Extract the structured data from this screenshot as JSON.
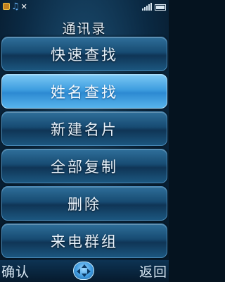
{
  "status_bar": {
    "icons": [
      "app-logo-icon",
      "music-note-icon",
      "mute-icon",
      "signal-icon",
      "battery-icon"
    ]
  },
  "title": "通讯录",
  "menu": {
    "items": [
      {
        "label": "快速查找"
      },
      {
        "label": "姓名查找",
        "selected": true
      },
      {
        "label": "新建名片"
      },
      {
        "label": "全部复制"
      },
      {
        "label": "删除"
      },
      {
        "label": "来电群组"
      }
    ]
  },
  "softkeys": {
    "left": "确认",
    "right": "返回",
    "center_icon": "navigation-pad-icon"
  },
  "colors": {
    "item_normal": "#174b72",
    "item_selected": "#3e9ee0",
    "text": "#e8f2fb"
  }
}
